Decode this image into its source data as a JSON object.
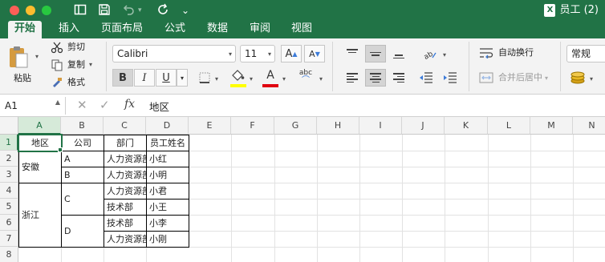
{
  "window": {
    "title": "员工 (2)",
    "file_badge": "X",
    "traffic_lights": {
      "close": "#fc5f57",
      "minimize": "#fdbc2e",
      "zoom": "#28c840"
    }
  },
  "toolbar_icons": [
    "sidebar-icon",
    "save-icon",
    "undo-icon",
    "redo-icon"
  ],
  "ribbon_tabs": [
    "开始",
    "插入",
    "页面布局",
    "公式",
    "数据",
    "审阅",
    "视图"
  ],
  "active_tab": "开始",
  "clipboard": {
    "paste": "粘贴",
    "cut": "剪切",
    "copy": "复制",
    "format": "格式"
  },
  "font": {
    "name": "Calibri",
    "size": "11",
    "bold": "B",
    "italic": "I",
    "underline": "U",
    "font_color_letter": "A",
    "phonetic_label": "abc"
  },
  "alignment": {
    "wrap_text": "自动换行",
    "merge_center": "合并后居中"
  },
  "number": {
    "format": "常规"
  },
  "formula_bar": {
    "name_box": "A1",
    "fx": "fx",
    "content": "地区"
  },
  "columns": [
    "A",
    "B",
    "C",
    "D",
    "E",
    "F",
    "G",
    "H",
    "I",
    "J",
    "K",
    "L",
    "M",
    "N"
  ],
  "rows": [
    "1",
    "2",
    "3",
    "4",
    "5",
    "6",
    "7",
    "8"
  ],
  "table": {
    "headers": [
      "地区",
      "公司",
      "部门",
      "员工姓名"
    ],
    "regions": [
      "安徽",
      "浙江"
    ],
    "companies": [
      "A",
      "B",
      "C",
      "D"
    ],
    "departments": [
      "人力资源部",
      "人力资源部",
      "人力资源部",
      "技术部",
      "技术部",
      "人力资源部"
    ],
    "employees": [
      "小红",
      "小明",
      "小君",
      "小王",
      "小李",
      "小刚"
    ]
  },
  "colors": {
    "excel_green": "#217346",
    "ribbon_bg": "#f3f3f3",
    "font_color_bar": "#e0000f",
    "fill_color_bar": "#ffff00"
  }
}
